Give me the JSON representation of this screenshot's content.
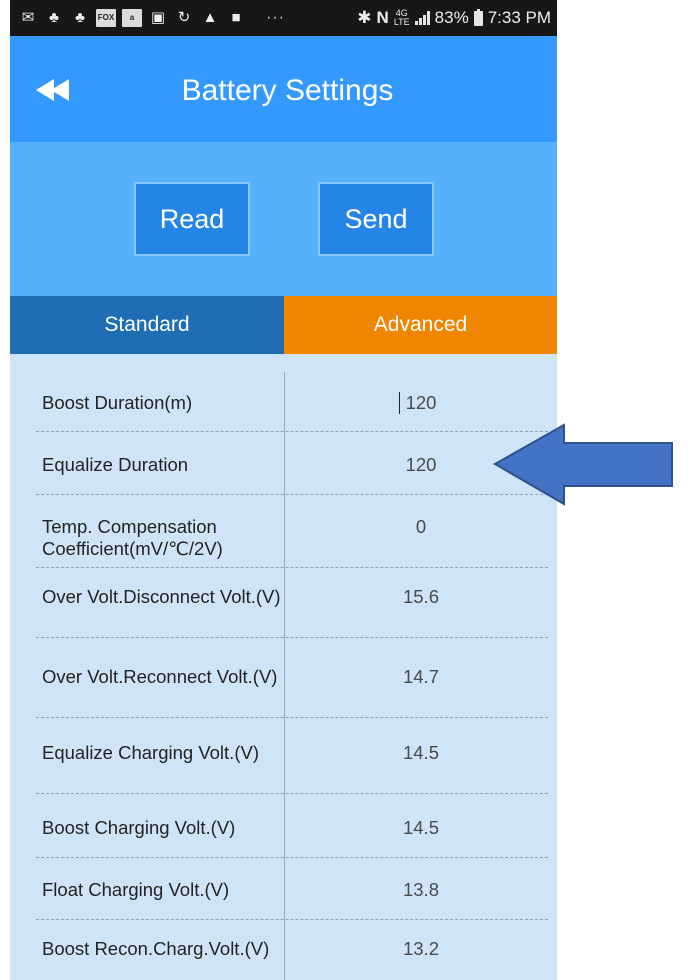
{
  "status_bar": {
    "left_icons": [
      "mail-icon",
      "stickman-icon",
      "stickman-icon",
      "fox-news-icon",
      "amazon-icon",
      "image-icon",
      "sync-icon",
      "warning-icon",
      "flipboard-icon"
    ],
    "overflow": "···",
    "battery_percent": "83%",
    "time": "7:33 PM",
    "network": "4G LTE"
  },
  "app_bar": {
    "title": "Battery Settings",
    "back_icon": "double-chevron-left-icon"
  },
  "actions": {
    "read_label": "Read",
    "send_label": "Send"
  },
  "tabs": {
    "standard": "Standard",
    "advanced": "Advanced",
    "selected": "Advanced"
  },
  "settings": [
    {
      "label": "Boost Duration(m)",
      "value": "120"
    },
    {
      "label": "Equalize Duration",
      "value": "120"
    },
    {
      "label": "Temp. Compensation Coefficient(mV/℃/2V)",
      "value": "0"
    },
    {
      "label": "Over Volt.Disconnect Volt.(V)",
      "value": "15.6"
    },
    {
      "label": "Over Volt.Reconnect Volt.(V)",
      "value": "14.7"
    },
    {
      "label": "Equalize Charging Volt.(V)",
      "value": "14.5"
    },
    {
      "label": "Boost Charging Volt.(V)",
      "value": "14.5"
    },
    {
      "label": "Float Charging Volt.(V)",
      "value": "13.8"
    },
    {
      "label": "Boost Recon.Charg.Volt.(V)",
      "value": "13.2"
    }
  ],
  "colors": {
    "app_bar": "#3399ff",
    "button_bar": "#56b0fb",
    "button": "#2585e6",
    "tab_standard": "#1f6db3",
    "tab_advanced": "#f08600",
    "list_bg": "#cfe5f7",
    "annotation_arrow": "#4472c4"
  }
}
